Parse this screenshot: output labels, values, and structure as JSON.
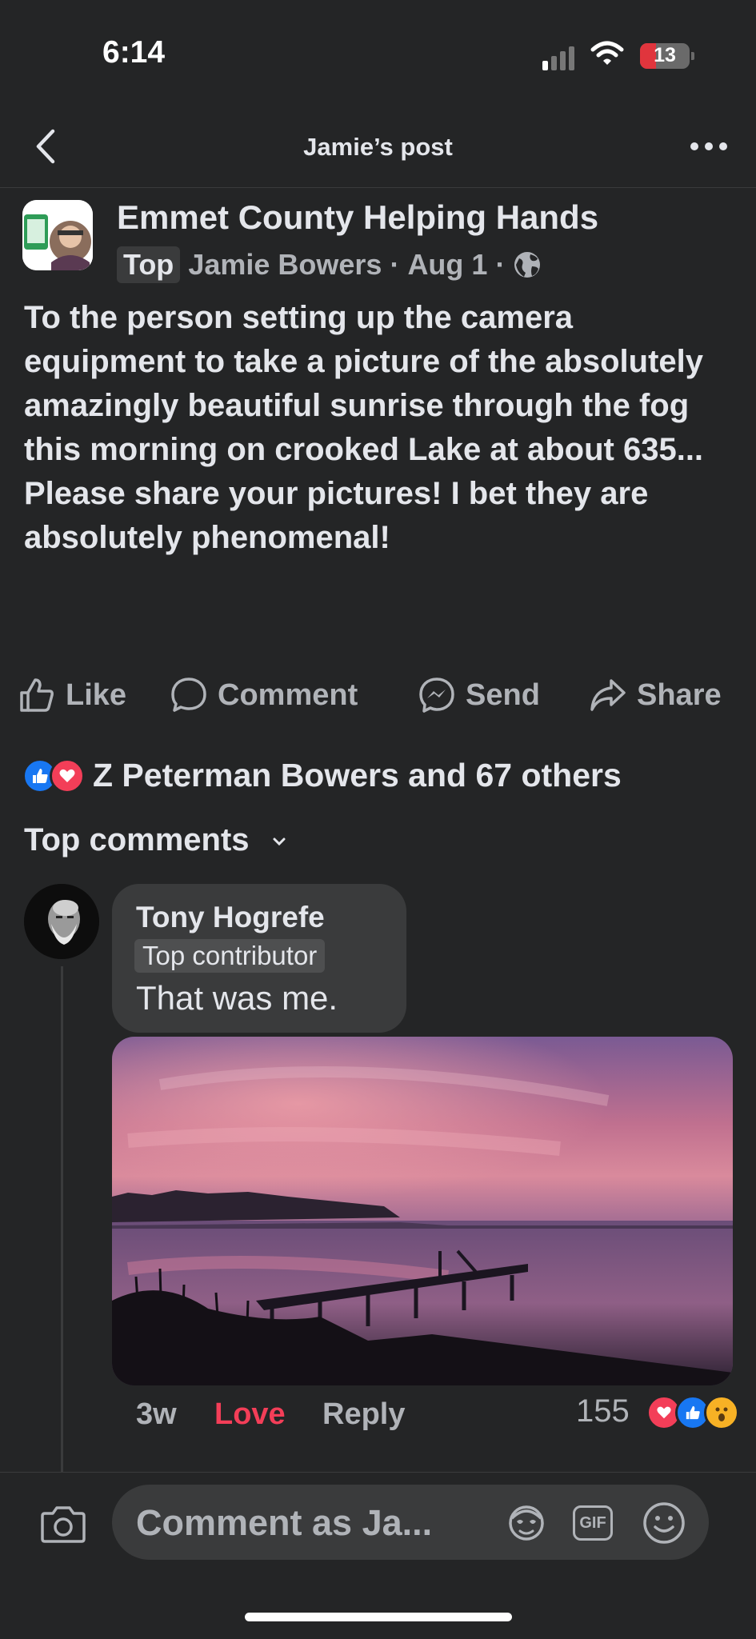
{
  "status_bar": {
    "time": "6:14",
    "battery": "13"
  },
  "nav": {
    "title": "Jamie’s post",
    "back_icon": "chevron-left-icon",
    "more_icon": "more-horizontal-icon"
  },
  "post": {
    "group_name": "Emmet County Helping Hands",
    "badge": "Top",
    "author": "Jamie Bowers",
    "date": "Aug 1",
    "sep1": "·",
    "sep2": "·",
    "privacy_icon": "globe-icon",
    "text": "To the person setting up the camera equipment to take a picture of the absolutely amazingly beautiful sunrise through the fog this morning on crooked Lake at about 635... Please share your pictures! I bet they are absolutely phenomenal!"
  },
  "actions": {
    "like": "Like",
    "comment": "Comment",
    "send": "Send",
    "share": "Share"
  },
  "reactions": {
    "text": "Z Peterman Bowers and 67 others"
  },
  "comments_header": {
    "label": "Top comments"
  },
  "comment": {
    "name": "Tony Hogrefe",
    "badge": "Top contributor",
    "text": "That was me.",
    "time": "3w",
    "love": "Love",
    "reply": "Reply",
    "reaction_count": "155"
  },
  "composer": {
    "placeholder": "Comment as Ja...",
    "gif_label": "GIF"
  },
  "colors": {
    "background": "#242526",
    "love": "#f33e58",
    "like_blue": "#1877f2"
  }
}
